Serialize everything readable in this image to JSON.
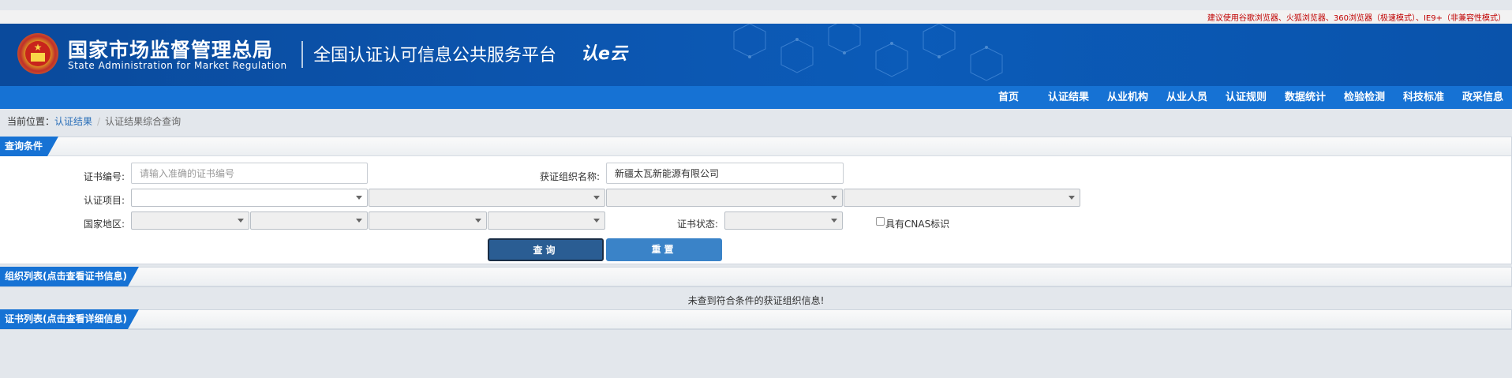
{
  "browser_tip": "建议使用谷歌浏览器、火狐浏览器、360浏览器（极速模式）、IE9+（非兼容性模式）",
  "header": {
    "agency_cn": "国家市场监督管理总局",
    "agency_en": "State Administration  for  Market Regulation",
    "platform_name": "全国认证认可信息公共服务平台",
    "logo_mark": "认e云"
  },
  "nav": {
    "items": [
      {
        "label": "首页"
      },
      {
        "label": "认证结果"
      },
      {
        "label": "从业机构"
      },
      {
        "label": "从业人员"
      },
      {
        "label": "认证规则"
      },
      {
        "label": "数据统计"
      },
      {
        "label": "检验检测"
      },
      {
        "label": "科技标准"
      },
      {
        "label": "政采信息"
      }
    ]
  },
  "breadcrumb": {
    "prefix": "当前位置：",
    "parent": "认证结果",
    "separator": "/",
    "current": "认证结果综合查询"
  },
  "query_panel": {
    "title": "查询条件",
    "cert_no_label": "证书编号:",
    "cert_no_placeholder": "请输入准确的证书编号",
    "cert_no_value": "",
    "org_name_label": "获证组织名称:",
    "org_name_value": "新疆太瓦新能源有限公司",
    "project_label": "认证项目:",
    "region_label": "国家地区:",
    "status_label": "证书状态:",
    "cnas_label": "具有CNAS标识",
    "query_button": "查询",
    "reset_button": "重置"
  },
  "org_list": {
    "title": "组织列表(点击查看证书信息)",
    "empty_message": "未查到符合条件的获证组织信息!"
  },
  "cert_list": {
    "title": "证书列表(点击查看详细信息)"
  },
  "colors": {
    "header_bg": "#0a4a9c",
    "nav_bg": "#1672d4",
    "tab_bg": "#1672d4",
    "query_button": "#2a5d93",
    "reset_button": "#3a83c8",
    "tip_text": "#c00000",
    "link": "#2a6fb9"
  }
}
